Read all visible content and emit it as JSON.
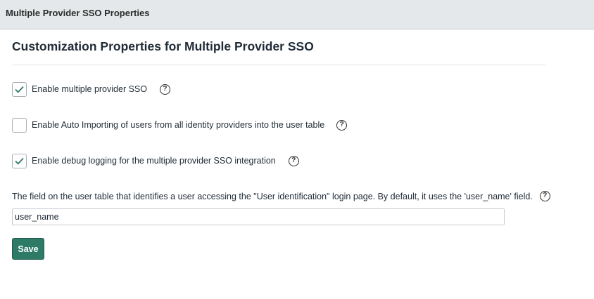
{
  "header": {
    "title": "Multiple Provider SSO Properties"
  },
  "main": {
    "title": "Customization Properties for Multiple Provider SSO",
    "options": [
      {
        "label": "Enable multiple provider SSO",
        "checked": true
      },
      {
        "label": "Enable Auto Importing of users from all identity providers into the user table",
        "checked": false
      },
      {
        "label": "Enable debug logging for the multiple provider SSO integration",
        "checked": true
      }
    ],
    "help_glyph": "?",
    "field": {
      "label": "The field on the user table that identifies a user accessing the \"User identification\" login page. By default, it uses the 'user_name' field.",
      "value": "user_name"
    },
    "save_label": "Save"
  },
  "colors": {
    "accent": "#2d7a67",
    "check": "#2d7a67",
    "header_bg": "#e5e8ea"
  },
  "icons": {
    "checkbox_checked": "check-icon",
    "help": "question-circle-icon"
  }
}
